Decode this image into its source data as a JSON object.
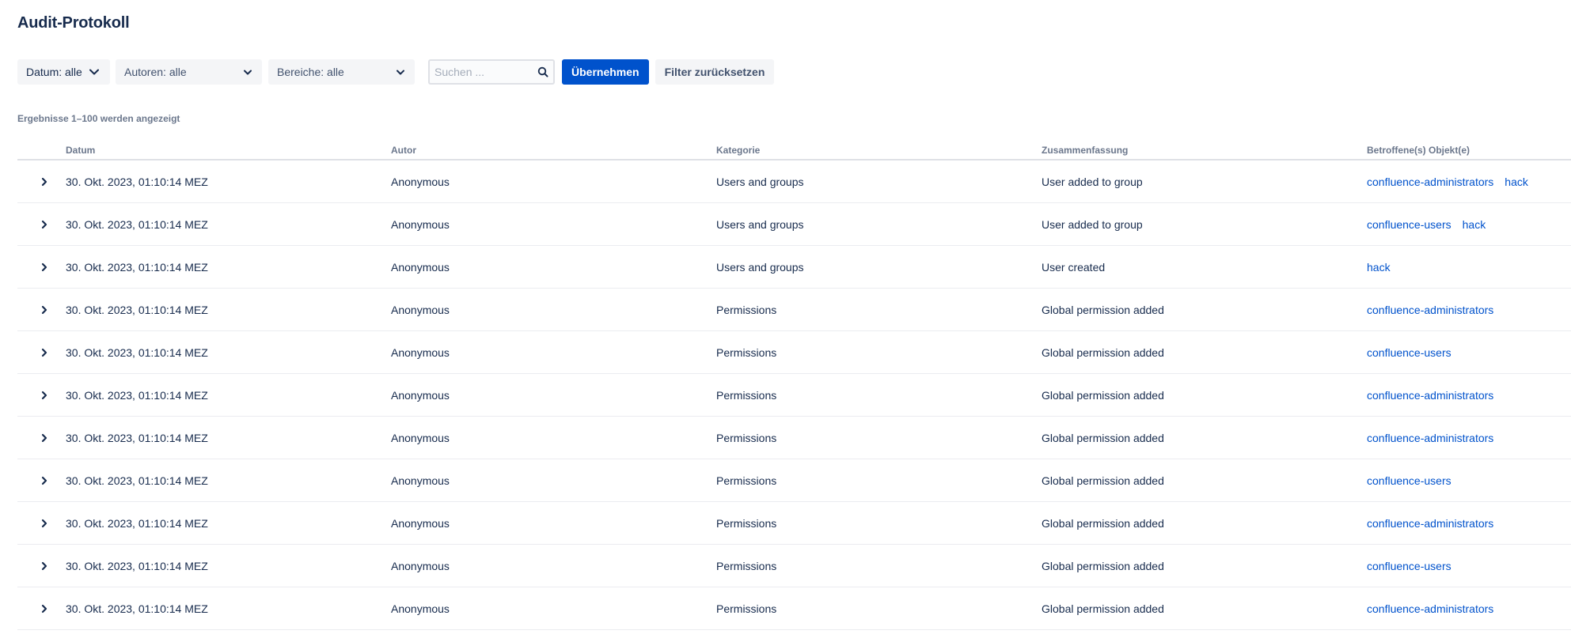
{
  "page": {
    "title": "Audit-Protokoll"
  },
  "filters": {
    "date_label": "Datum: alle",
    "author_label": "Autoren: alle",
    "area_label": "Bereiche: alle",
    "search_placeholder": "Suchen ...",
    "apply_label": "Übernehmen",
    "reset_label": "Filter zurücksetzen"
  },
  "results_info": "Ergebnisse 1–100 werden angezeigt",
  "table": {
    "headers": {
      "date": "Datum",
      "author": "Autor",
      "category": "Kategorie",
      "summary": "Zusammenfassung",
      "objects": "Betroffene(s) Objekt(e)"
    },
    "rows": [
      {
        "date": "30. Okt. 2023, 01:10:14 MEZ",
        "author": "Anonymous",
        "category": "Users and groups",
        "summary": "User added to group",
        "objects": [
          "confluence-administrators",
          "hack"
        ]
      },
      {
        "date": "30. Okt. 2023, 01:10:14 MEZ",
        "author": "Anonymous",
        "category": "Users and groups",
        "summary": "User added to group",
        "objects": [
          "confluence-users",
          "hack"
        ]
      },
      {
        "date": "30. Okt. 2023, 01:10:14 MEZ",
        "author": "Anonymous",
        "category": "Users and groups",
        "summary": "User created",
        "objects": [
          "hack"
        ]
      },
      {
        "date": "30. Okt. 2023, 01:10:14 MEZ",
        "author": "Anonymous",
        "category": "Permissions",
        "summary": "Global permission added",
        "objects": [
          "confluence-administrators"
        ]
      },
      {
        "date": "30. Okt. 2023, 01:10:14 MEZ",
        "author": "Anonymous",
        "category": "Permissions",
        "summary": "Global permission added",
        "objects": [
          "confluence-users"
        ]
      },
      {
        "date": "30. Okt. 2023, 01:10:14 MEZ",
        "author": "Anonymous",
        "category": "Permissions",
        "summary": "Global permission added",
        "objects": [
          "confluence-administrators"
        ]
      },
      {
        "date": "30. Okt. 2023, 01:10:14 MEZ",
        "author": "Anonymous",
        "category": "Permissions",
        "summary": "Global permission added",
        "objects": [
          "confluence-administrators"
        ]
      },
      {
        "date": "30. Okt. 2023, 01:10:14 MEZ",
        "author": "Anonymous",
        "category": "Permissions",
        "summary": "Global permission added",
        "objects": [
          "confluence-users"
        ]
      },
      {
        "date": "30. Okt. 2023, 01:10:14 MEZ",
        "author": "Anonymous",
        "category": "Permissions",
        "summary": "Global permission added",
        "objects": [
          "confluence-administrators"
        ]
      },
      {
        "date": "30. Okt. 2023, 01:10:14 MEZ",
        "author": "Anonymous",
        "category": "Permissions",
        "summary": "Global permission added",
        "objects": [
          "confluence-users"
        ]
      },
      {
        "date": "30. Okt. 2023, 01:10:14 MEZ",
        "author": "Anonymous",
        "category": "Permissions",
        "summary": "Global permission added",
        "objects": [
          "confluence-administrators"
        ]
      }
    ]
  },
  "colors": {
    "primary": "#0052cc",
    "text": "#172b4d",
    "subtle": "#6b778c",
    "link": "#0052cc"
  },
  "icons": {
    "expand": "chevron-right-icon",
    "dropdown": "chevron-down-icon",
    "search": "search-icon"
  }
}
